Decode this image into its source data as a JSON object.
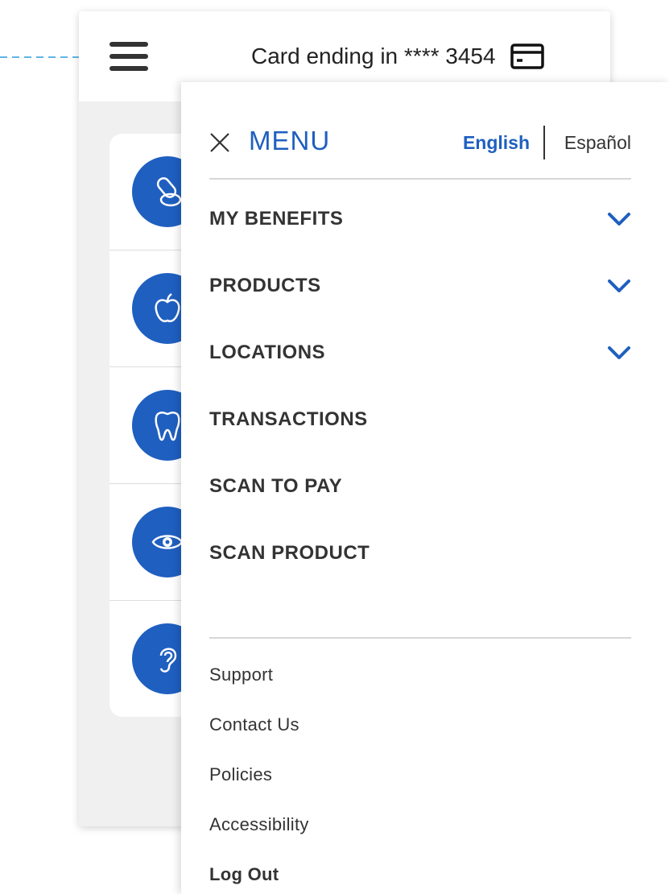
{
  "header": {
    "card_label": "Card ending in **** 3454"
  },
  "benefit_icons": [
    "pills-icon",
    "apple-icon",
    "tooth-icon",
    "eye-icon",
    "ear-icon"
  ],
  "menu": {
    "title": "MENU",
    "languages": {
      "english": "English",
      "spanish": "Español",
      "selected": "English"
    },
    "primary_items": [
      {
        "label": "MY BENEFITS",
        "expandable": true
      },
      {
        "label": "PRODUCTS",
        "expandable": true
      },
      {
        "label": "LOCATIONS",
        "expandable": true
      },
      {
        "label": "TRANSACTIONS",
        "expandable": false
      },
      {
        "label": "SCAN TO PAY",
        "expandable": false
      },
      {
        "label": "SCAN PRODUCT",
        "expandable": false
      }
    ],
    "secondary_items": [
      {
        "label": "Support"
      },
      {
        "label": "Contact Us"
      },
      {
        "label": "Policies"
      },
      {
        "label": "Accessibility"
      },
      {
        "label": "Log Out"
      }
    ]
  },
  "colors": {
    "brand_blue": "#1f5fc0",
    "text_dark": "#333333",
    "pointer_dash": "#5fb4e6"
  }
}
